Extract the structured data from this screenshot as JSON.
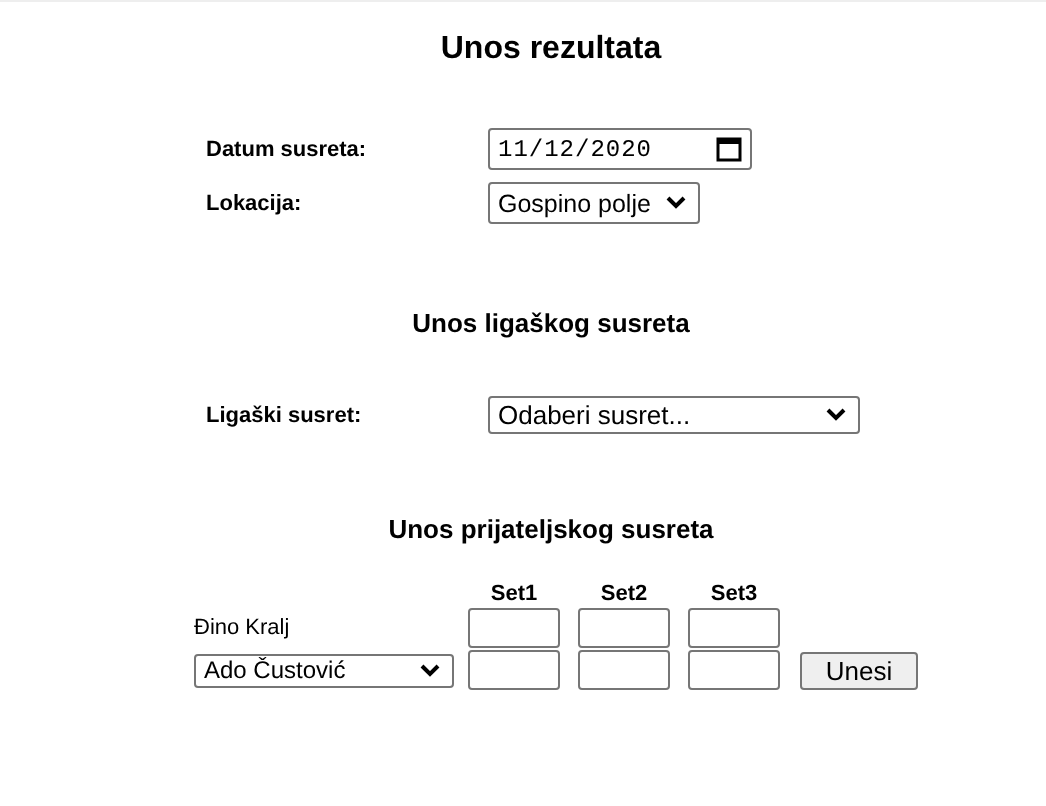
{
  "title": "Unos rezultata",
  "date": {
    "label": "Datum susreta:",
    "value": "11/12/2020"
  },
  "location": {
    "label": "Lokacija:",
    "value": "Gospino polje"
  },
  "league": {
    "heading": "Unos ligaškog susreta",
    "label": "Ligaški susret:",
    "value": "Odaberi susret..."
  },
  "friendly": {
    "heading": "Unos prijateljskog susreta",
    "columns": [
      "Set1",
      "Set2",
      "Set3"
    ],
    "rows": [
      {
        "kind": "text",
        "player": "Đino Kralj"
      },
      {
        "kind": "select",
        "player": "Ado Čustović"
      }
    ],
    "button": "Unesi"
  }
}
